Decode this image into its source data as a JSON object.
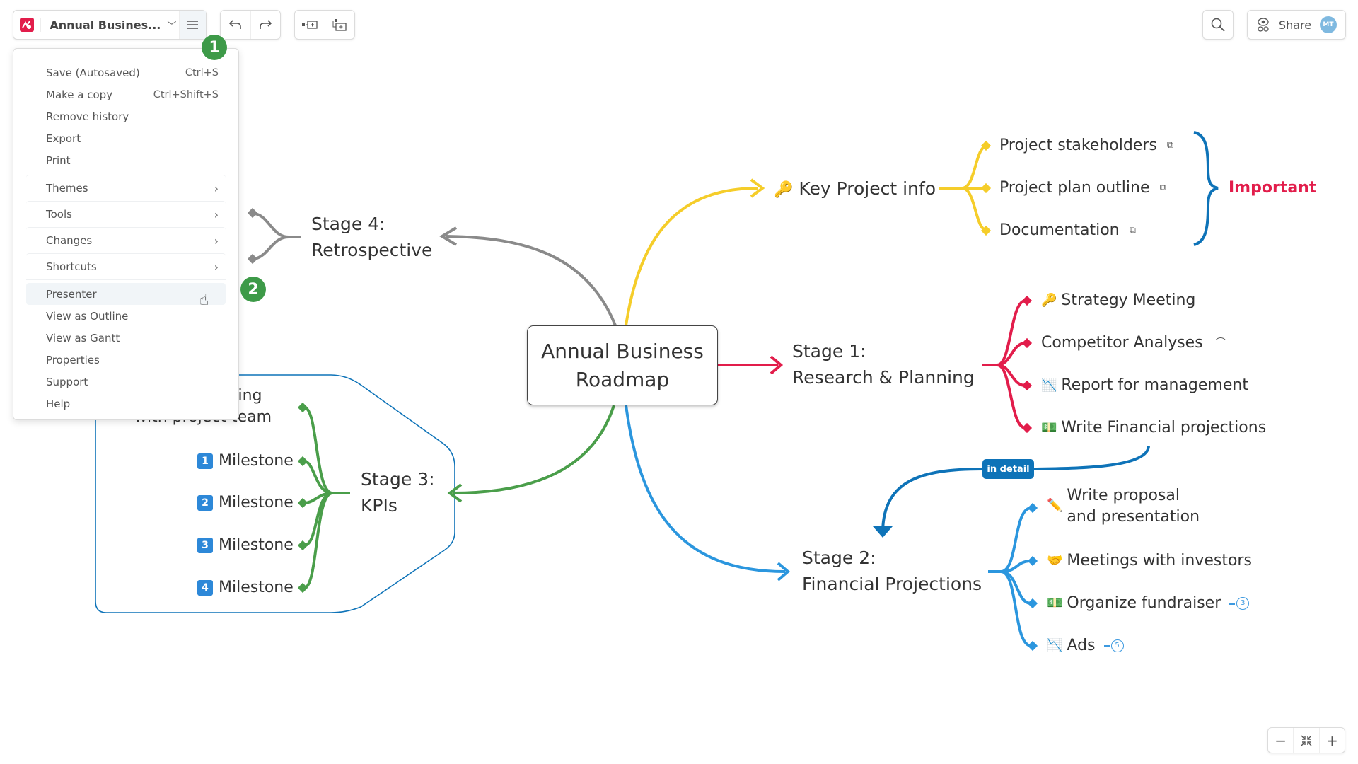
{
  "toolbar": {
    "doc_title": "Annual Busines...",
    "app_logo": "mindmeister-logo-icon",
    "title_dropdown_icon": "chevron-down-icon",
    "menu_icon": "hamburger-menu-icon",
    "undo_icon": "undo-icon",
    "redo_icon": "redo-icon",
    "add_sibling_icon": "add-sibling-topic-icon",
    "add_child_icon": "add-child-topic-icon",
    "search_icon": "search-icon",
    "share_label": "Share",
    "share_icon": "share-eye-icon",
    "avatar_initials": "MT"
  },
  "annotations": {
    "badge1": "1",
    "badge2": "2"
  },
  "menu": {
    "items": [
      {
        "label": "Save (Autosaved)",
        "shortcut": "Ctrl+S"
      },
      {
        "label": "Make a copy",
        "shortcut": "Ctrl+Shift+S"
      },
      {
        "label": "Remove history",
        "shortcut": ""
      },
      {
        "label": "Export",
        "shortcut": ""
      },
      {
        "label": "Print",
        "shortcut": ""
      }
    ],
    "submenus": [
      {
        "label": "Themes"
      },
      {
        "label": "Tools"
      },
      {
        "label": "Changes"
      },
      {
        "label": "Shortcuts"
      }
    ],
    "views": [
      {
        "label": "Presenter",
        "hovered": true
      },
      {
        "label": "View as Outline"
      },
      {
        "label": "View as Gantt"
      },
      {
        "label": "Properties"
      },
      {
        "label": "Support"
      },
      {
        "label": "Help"
      }
    ]
  },
  "mindmap": {
    "central": {
      "line1": "Annual Business",
      "line2": "Roadmap"
    },
    "colors": {
      "key": "#f5cd2a",
      "stage1": "#e21d4b",
      "stage2": "#2b96de",
      "stage3": "#4a9e4a",
      "stage4": "#8a8a8a",
      "connector": "#0e73b8",
      "important": "#e21d4b"
    },
    "key_info": {
      "label": "Key Project info",
      "icon": "key-icon",
      "children": [
        {
          "label": "Project stakeholders",
          "link_icon": "external-link-icon"
        },
        {
          "label": "Project plan outline",
          "link_icon": "external-link-icon"
        },
        {
          "label": "Documentation",
          "link_icon": "external-link-icon"
        }
      ],
      "boundary_label": "Important"
    },
    "stage1": {
      "line1": "Stage 1:",
      "line2": "Research & Planning",
      "children": [
        {
          "label": "Strategy Meeting",
          "icon": "key-icon"
        },
        {
          "label": "Competitor Analyses",
          "icon": "",
          "suffix_icon": "attachment-icon"
        },
        {
          "label": "Report for management",
          "icon": "chart-down-icon"
        },
        {
          "label": "Write Financial projections",
          "icon": "money-icon"
        }
      ]
    },
    "connector_label": "in detail",
    "stage2": {
      "line1": "Stage 2:",
      "line2": "Financial Projections",
      "children": [
        {
          "line1": "Write proposal",
          "line2": "and presentation",
          "icon": "pencil-icon"
        },
        {
          "label": "Meetings with investors",
          "icon": "handshake-icon"
        },
        {
          "label": "Organize fundraiser",
          "icon": "money-icon",
          "collapsed_count": "3"
        },
        {
          "label": "Ads",
          "icon": "chart-down-icon",
          "collapsed_count": "5"
        }
      ]
    },
    "stage3": {
      "line1": "Stage 3:",
      "line2": "KPIs",
      "children": [
        {
          "line1": "...eting",
          "line2": "with project team"
        },
        {
          "label": "Milestone",
          "num": "1"
        },
        {
          "label": "Milestone",
          "num": "2"
        },
        {
          "label": "Milestone",
          "num": "3"
        },
        {
          "label": "Milestone",
          "num": "4"
        }
      ]
    },
    "stage4": {
      "line1": "Stage 4:",
      "line2": "Retrospective"
    }
  },
  "zoom_controls": {
    "minus": "−",
    "fit_icon": "fit-to-screen-icon",
    "plus": "+"
  }
}
